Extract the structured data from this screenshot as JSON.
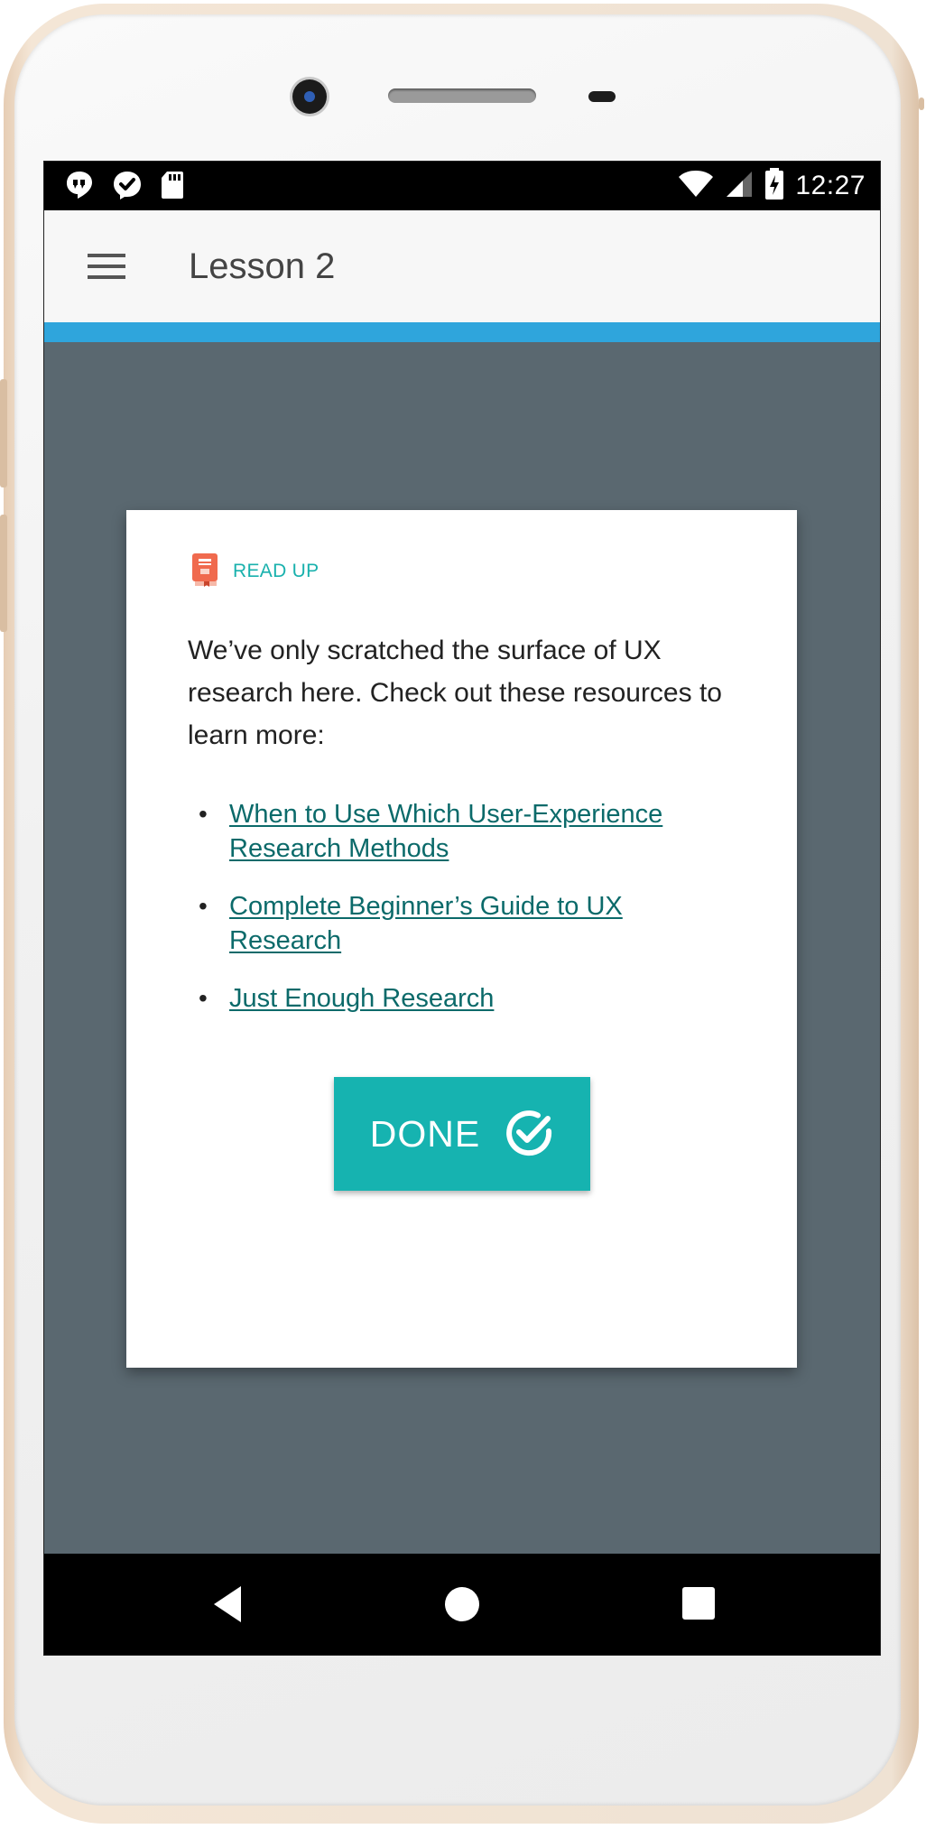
{
  "status_bar": {
    "time": "12:27",
    "left_icons": [
      "hangouts-icon",
      "messenger-check-icon",
      "sd-card-icon"
    ],
    "right_icons": [
      "wifi-icon",
      "cell-signal-icon",
      "battery-charging-icon"
    ]
  },
  "app_bar": {
    "title": "Lesson 2",
    "menu_icon": "hamburger-menu-icon"
  },
  "card": {
    "tag": "READ UP",
    "tag_icon": "book-icon",
    "body": "We’ve only scratched the surface of UX research here. Check out these resources to learn more:",
    "resources": [
      {
        "label": "When to Use Which User-Experience Research Methods"
      },
      {
        "label": "Complete Beginner’s Guide to UX Research"
      },
      {
        "label": "Just Enough Research"
      }
    ],
    "done_button": {
      "label": "DONE",
      "icon": "check-circle-icon"
    }
  },
  "nav_bar": {
    "buttons": [
      "back-icon",
      "home-icon",
      "recents-icon"
    ]
  },
  "colors": {
    "accent": "#16b3b0",
    "link": "#0b6a6a",
    "progress": "#2fa5dc",
    "background": "#5a6870",
    "tag_icon": "#f06a4e"
  }
}
